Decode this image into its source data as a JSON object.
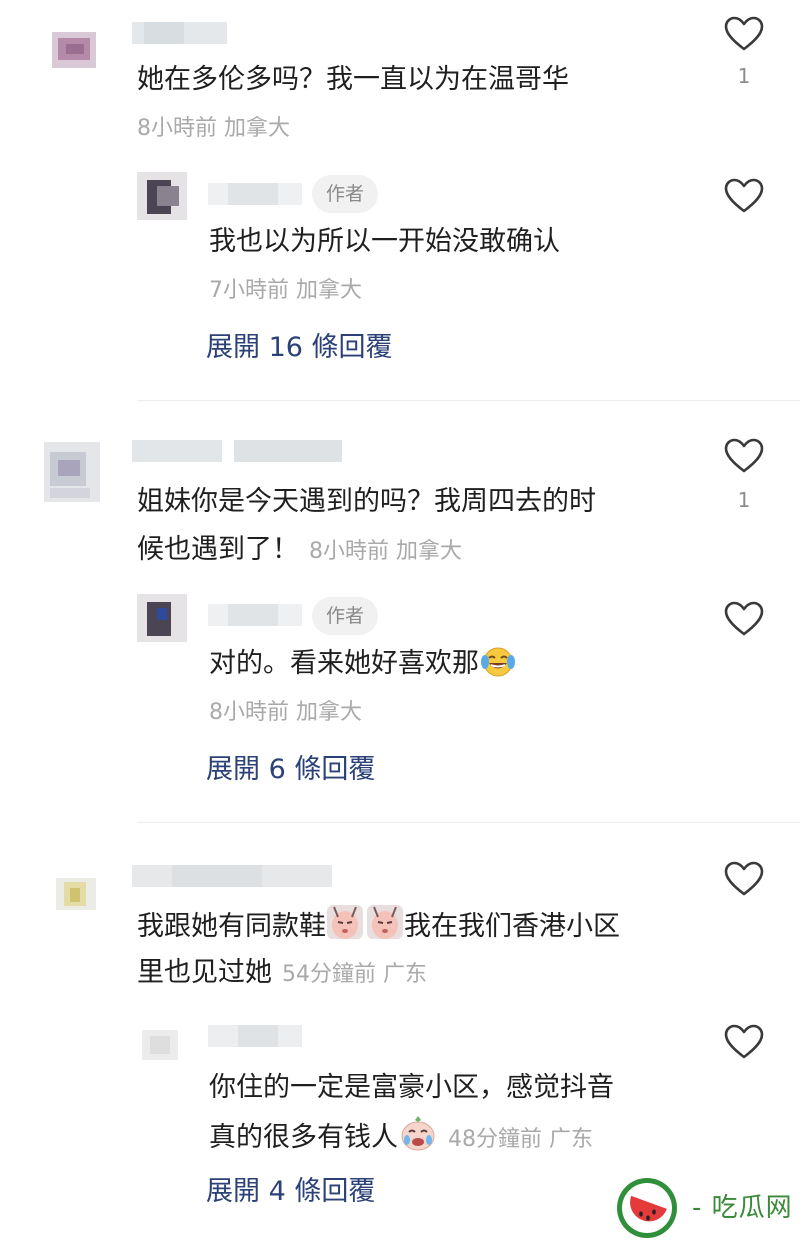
{
  "comments": [
    {
      "text": "她在多伦多吗？我一直以为在温哥华",
      "meta": "8小時前 加拿大",
      "like_count": "1",
      "reply": {
        "badge": "作者",
        "text": "我也以为所以一开始没敢确认",
        "meta": "7小時前 加拿大"
      },
      "expand_label": "展開 16 條回覆"
    },
    {
      "text_line1": "姐妹你是今天遇到的吗？我周四去的时",
      "text_line2": "候也遇到了！",
      "meta": "8小時前 加拿大",
      "like_count": "1",
      "reply": {
        "badge": "作者",
        "text": "对的。看来她好喜欢那",
        "emoji": "tears-of-joy-emoji",
        "meta": "8小時前 加拿大"
      },
      "expand_label": "展開 6 條回覆"
    },
    {
      "text_line1a": "我跟她有同款鞋",
      "text_line1b": "我在我们香港小区",
      "text_line2": "里也见过她",
      "meta": "54分鐘前 广东",
      "sticker": "shy-face-sticker",
      "reply": {
        "text_line1": "你住的一定是富豪小区，感觉抖音",
        "text_line2": "真的很多有钱人",
        "sticker": "crying-face-sticker",
        "meta": "48分鐘前 广东"
      },
      "expand_label": "展開 4 條回覆"
    }
  ],
  "watermark": {
    "text": "- 吃瓜网 -",
    "icon": "watermelon-icon"
  },
  "colors": {
    "link": "#2b4177",
    "meta": "#a9a9a9",
    "badge_bg": "#f1f1f1"
  }
}
